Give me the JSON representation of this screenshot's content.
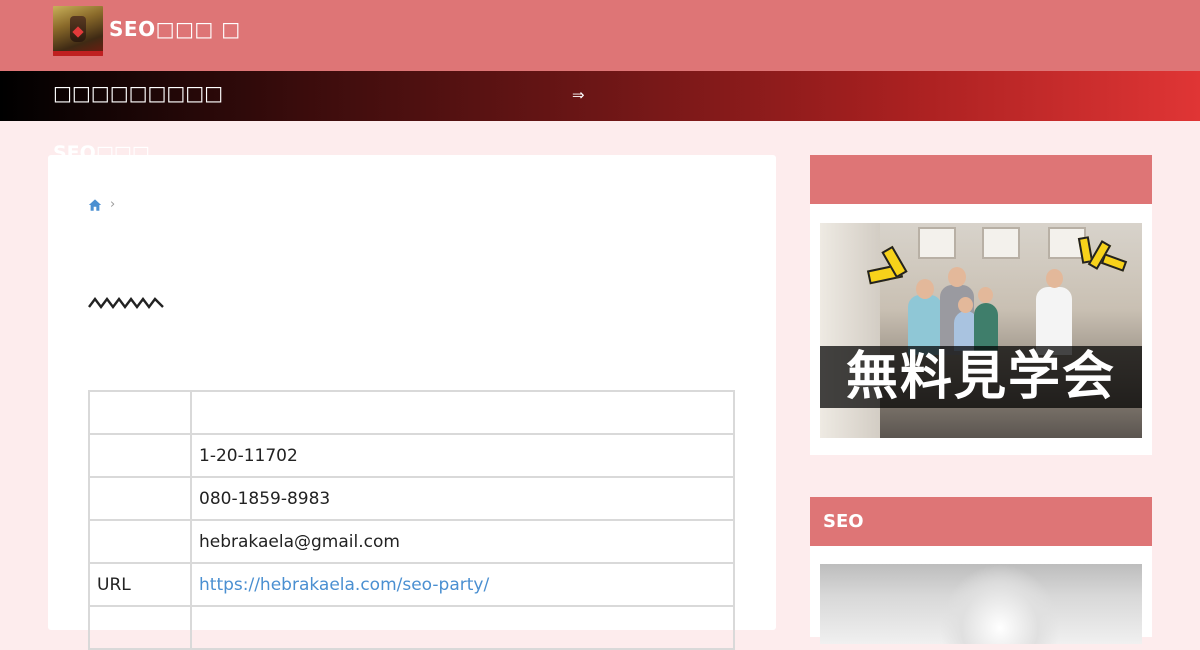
{
  "header": {
    "site_title": "SEO□□□ □",
    "logo_icon": "honey-jar-logo-icon",
    "background": "#de7576"
  },
  "notice": {
    "text": "□□□□□□□□□",
    "arrow": "⇒"
  },
  "page_heading": "SEO□□□",
  "breadcrumb": {
    "home_icon": "home-icon",
    "separator": "›"
  },
  "profile_table": {
    "rows": [
      {
        "label": "",
        "value": ""
      },
      {
        "label": "",
        "value": "1-20-11702"
      },
      {
        "label": "",
        "value": "080-1859-8983"
      },
      {
        "label": "",
        "value": "hebrakaela@gmail.com"
      },
      {
        "label": "URL",
        "value": "https://hebrakaela.com/seo-party/",
        "link": true
      },
      {
        "label": "",
        "value": ""
      }
    ]
  },
  "sidebar": {
    "widget1": {
      "title": "",
      "banner_caption": "無料見学会"
    },
    "widget2": {
      "title": "SEO"
    }
  },
  "colors": {
    "accent": "#de7576",
    "page_bg": "#fdeced",
    "link": "#4a8fd1"
  }
}
